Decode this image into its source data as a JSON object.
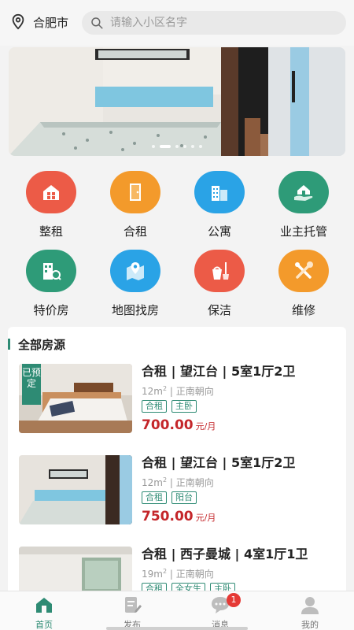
{
  "header": {
    "city": "合肥市",
    "search_placeholder": "请输入小区名字"
  },
  "banner": {
    "dot_count": 6,
    "active_index": 1
  },
  "categories": [
    {
      "label": "整租",
      "icon": "house-icon",
      "color": "#ec5b47"
    },
    {
      "label": "合租",
      "icon": "door-icon",
      "color": "#f39a2b"
    },
    {
      "label": "公寓",
      "icon": "apartment-icon",
      "color": "#2aa3e6"
    },
    {
      "label": "业主托管",
      "icon": "hand-house-icon",
      "color": "#2e9b78"
    },
    {
      "label": "特价房",
      "icon": "price-building-icon",
      "color": "#2e9b78"
    },
    {
      "label": "地图找房",
      "icon": "map-icon",
      "color": "#2aa3e6"
    },
    {
      "label": "保洁",
      "icon": "cleaning-icon",
      "color": "#ec5b47"
    },
    {
      "label": "维修",
      "icon": "tools-icon",
      "color": "#f39a2b"
    }
  ],
  "listing": {
    "title": "全部房源",
    "items": [
      {
        "ribbon": "已预定",
        "title": "合租 | 望江台 | 5室1厅2卫",
        "area": "12m",
        "sup": "2",
        "orientation": "正南朝向",
        "tags": [
          "合租",
          "主卧"
        ],
        "price": "700.00",
        "unit": "元/月"
      },
      {
        "ribbon": "",
        "title": "合租 | 望江台 | 5室1厅2卫",
        "area": "12m",
        "sup": "2",
        "orientation": "正南朝向",
        "tags": [
          "合租",
          "阳台"
        ],
        "price": "750.00",
        "unit": "元/月"
      },
      {
        "ribbon": "",
        "title": "合租 | 西子曼城 | 4室1厅1卫",
        "area": "19m",
        "sup": "2",
        "orientation": "正南朝向",
        "tags": [
          "合租",
          "全女生",
          "主卧"
        ],
        "price": "",
        "unit": ""
      }
    ]
  },
  "tabbar": {
    "tabs": [
      {
        "label": "首页",
        "icon": "home-icon",
        "active": true
      },
      {
        "label": "发布",
        "icon": "publish-icon",
        "active": false
      },
      {
        "label": "消息",
        "icon": "message-icon",
        "active": false,
        "badge": "1"
      },
      {
        "label": "我的",
        "icon": "profile-icon",
        "active": false
      }
    ]
  },
  "colors": {
    "accent": "#2e8b74",
    "price": "#c4262a"
  }
}
